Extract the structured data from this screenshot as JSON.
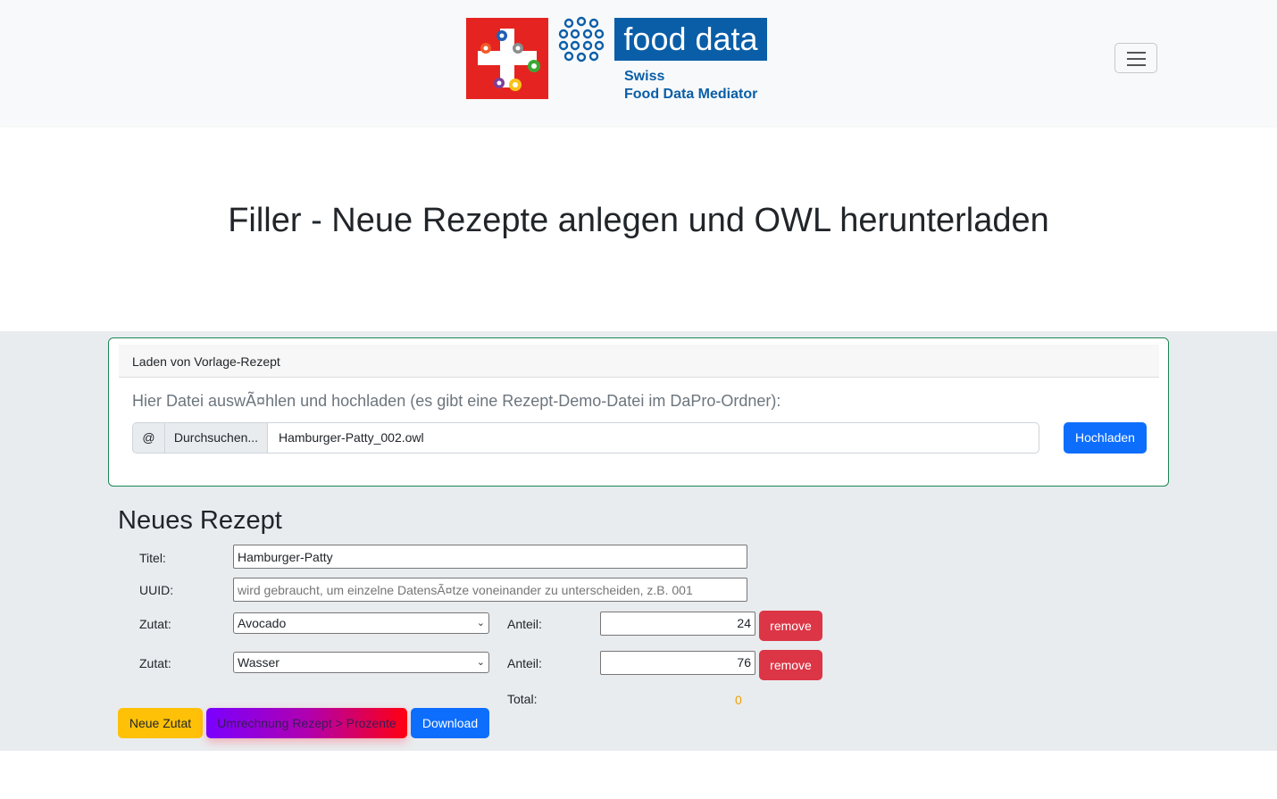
{
  "brand": {
    "logo_text": "food data",
    "sub_line1": "Swiss",
    "sub_line2": "Food Data Mediator",
    "colors": {
      "brand_blue": "#0a5ea8",
      "flag_red": "#e52421"
    }
  },
  "navbar": {
    "toggler_icon": "hamburger-icon"
  },
  "hero": {
    "title": "Filler - Neue Rezepte anlegen und OWL herunterladen"
  },
  "upload_card": {
    "header": "Laden von Vorlage-Rezept",
    "instruction": "Hier Datei auswÃ¤hlen und hochladen (es gibt eine Rezept-Demo-Datei im DaPro-Ordner):",
    "at_symbol": "@",
    "browse_label": "Durchsuchen...",
    "file_name": "Hamburger-Patty_002.owl",
    "upload_button": "Hochladen"
  },
  "form": {
    "heading": "Neues Rezept",
    "title_label": "Titel:",
    "title_value": "Hamburger-Patty",
    "uuid_label": "UUID:",
    "uuid_placeholder": "wird gebraucht, um einzelne DatensÃ¤tze voneinander zu unterscheiden, z.B. 001",
    "ingredients": [
      {
        "label": "Zutat:",
        "value": "Avocado",
        "share_label": "Anteil:",
        "share": "24",
        "remove_label": "remove"
      },
      {
        "label": "Zutat:",
        "value": "Wasser",
        "share_label": "Anteil:",
        "share": "76",
        "remove_label": "remove"
      }
    ],
    "total_label": "Total:",
    "total_value": "0",
    "buttons": {
      "new_ingredient": "Neue Zutat",
      "convert": "Umrechnung Rezept > Prozente",
      "download": "Download"
    }
  }
}
